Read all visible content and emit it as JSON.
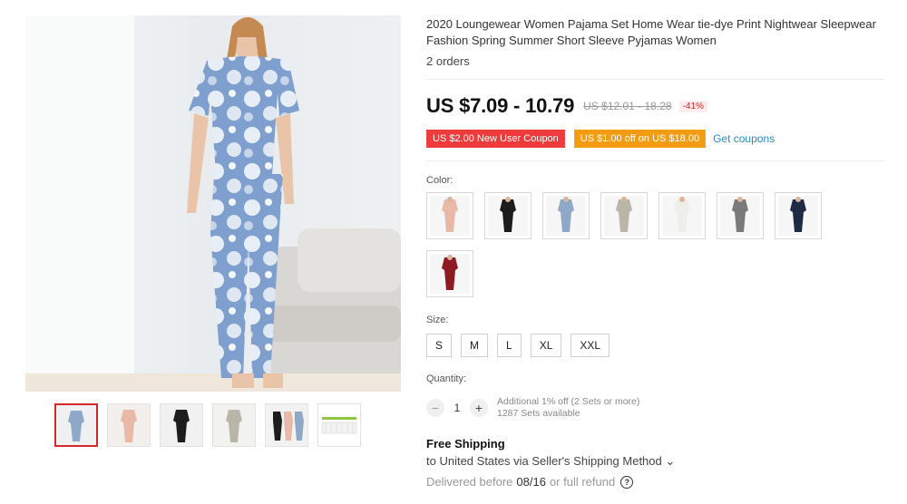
{
  "product": {
    "title": "2020 Loungewear Women Pajama Set Home Wear tie-dye Print Nightwear Sleepwear Fashion Spring Summer Short Sleeve Pyjamas Women",
    "orders": "2 orders"
  },
  "price": {
    "current": "US $7.09 - 10.79",
    "original": "US $12.01 - 18.28",
    "discount": "-41%"
  },
  "coupons": {
    "new_user": "US $2.00 New User Coupon",
    "store": "US $1.00 off on US $18.00",
    "get_link": "Get coupons"
  },
  "color": {
    "label": "Color:",
    "swatches": [
      {
        "name": "pink tie-dye",
        "fill": "#e8b9a7"
      },
      {
        "name": "black",
        "fill": "#1c1c1c"
      },
      {
        "name": "blue tie-dye",
        "fill": "#8fa8c8"
      },
      {
        "name": "grey camo",
        "fill": "#b9b5a8"
      },
      {
        "name": "white-black",
        "fill": "#eeeeea"
      },
      {
        "name": "grey-black",
        "fill": "#7a7a78"
      },
      {
        "name": "navy",
        "fill": "#1f2a44"
      },
      {
        "name": "wine red",
        "fill": "#8e1b22"
      }
    ]
  },
  "size": {
    "label": "Size:",
    "options": [
      "S",
      "M",
      "L",
      "XL",
      "XXL"
    ]
  },
  "quantity": {
    "label": "Quantity:",
    "minus": "−",
    "value": "1",
    "plus": "+",
    "discount_note": "Additional 1% off (2 Sets or more)",
    "available": "1287 Sets available"
  },
  "shipping": {
    "title": "Free Shipping",
    "to": "to United States via Seller's Shipping Method",
    "chevron": "⌄",
    "delivered_prefix": "Delivered before",
    "delivered_date": "08/16",
    "delivered_suffix": "or full refund",
    "help": "?"
  },
  "colors": {
    "accent_red": "#ef3b3b",
    "accent_orange": "#f39c12",
    "link_blue": "#2a8bc4",
    "selected_border": "#d62828"
  }
}
